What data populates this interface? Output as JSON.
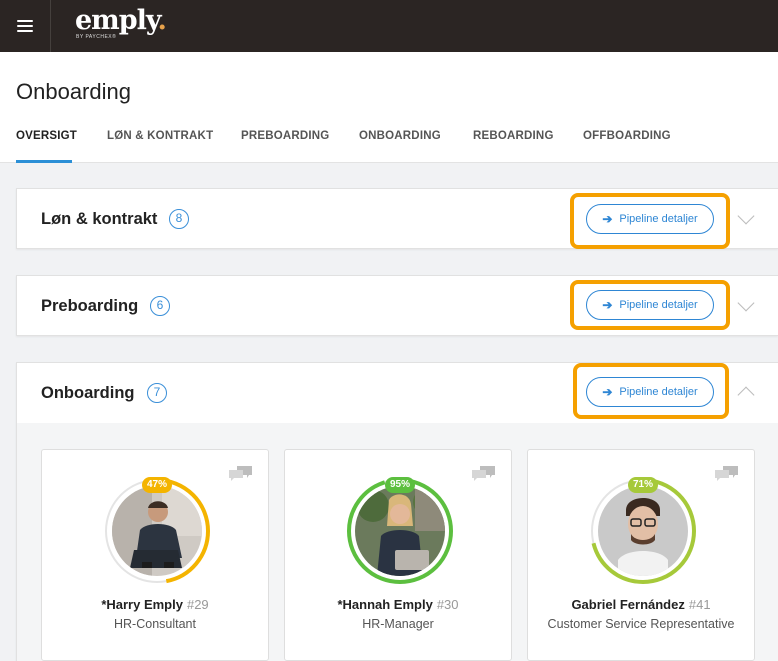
{
  "app": {
    "logo_text": "emply",
    "logo_dot": ".",
    "logo_sub": "BY PAYCHEX®",
    "brand_accent": "#e8a24b"
  },
  "page": {
    "title": "Onboarding"
  },
  "tabs": [
    {
      "label": "OVERSIGT",
      "active": true
    },
    {
      "label": "LØN & KONTRAKT"
    },
    {
      "label": "PREBOARDING"
    },
    {
      "label": "ONBOARDING"
    },
    {
      "label": "REBOARDING"
    },
    {
      "label": "OFFBOARDING"
    }
  ],
  "sections": [
    {
      "title": "Løn & kontrakt",
      "count": "8",
      "button_label": "Pipeline detaljer",
      "button_icon": "arrow-right-icon",
      "expanded": false
    },
    {
      "title": "Preboarding",
      "count": "6",
      "button_label": "Pipeline detaljer",
      "button_icon": "arrow-right-icon",
      "expanded": false
    },
    {
      "title": "Onboarding",
      "count": "7",
      "button_label": "Pipeline detaljer",
      "button_icon": "arrow-right-icon",
      "expanded": true
    }
  ],
  "onboarding_cards": [
    {
      "name": "*Harry Emply",
      "id": "#29",
      "role": "HR-Consultant",
      "progress_label": "47%",
      "progress": 0.47,
      "color": "#f4b400"
    },
    {
      "name": "*Hannah Emply",
      "id": "#30",
      "role": "HR-Manager",
      "progress_label": "95%",
      "progress": 0.95,
      "color": "#5cbf3f"
    },
    {
      "name": "Gabriel Fernández",
      "id": "#41",
      "role": "Customer Service Representative",
      "progress_label": "71%",
      "progress": 0.71,
      "color": "#a6c93a"
    }
  ],
  "colors": {
    "highlight": "#f5a000",
    "link": "#2e86d4",
    "topbar": "#2b2523"
  }
}
